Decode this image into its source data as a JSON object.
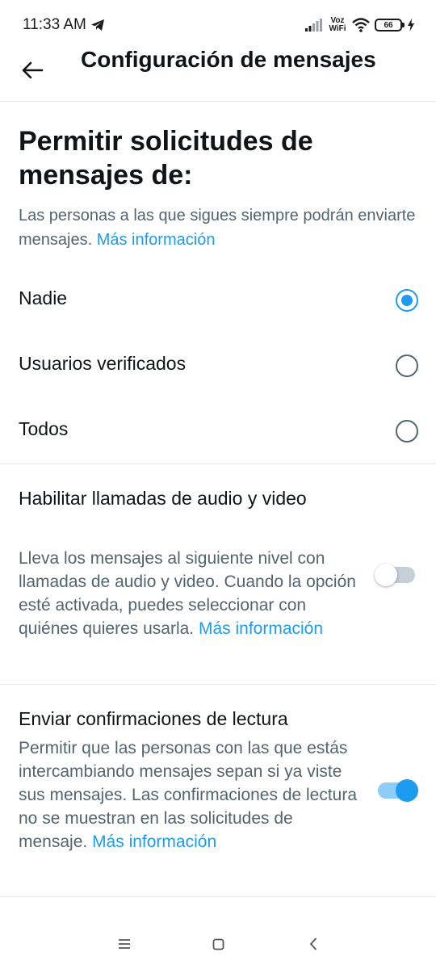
{
  "status_bar": {
    "time": "11:33 AM",
    "network_label": "Voz WiFi",
    "battery": "66",
    "icons": [
      "telegram-icon",
      "signal-icon",
      "wifi-icon",
      "battery-icon",
      "bolt-icon"
    ]
  },
  "header": {
    "back_icon": "arrow-left-icon",
    "title": "Configuración de mensajes"
  },
  "message_requests": {
    "heading": "Permitir solicitudes de mensajes de:",
    "description": "Las personas a las que sigues siempre podrán enviarte mensajes.",
    "link": "Más información",
    "options": [
      {
        "label": "Nadie",
        "selected": true
      },
      {
        "label": "Usuarios verificados",
        "selected": false
      },
      {
        "label": "Todos",
        "selected": false
      }
    ]
  },
  "calls": {
    "title": "Habilitar llamadas de audio y video",
    "description": "Lleva los mensajes al siguiente nivel con llamadas de audio y video. Cuando la opción esté activada, puedes seleccionar con quiénes quieres usarla.",
    "link": "Más información",
    "enabled": false
  },
  "read_receipts": {
    "title": "Enviar confirmaciones de lectura",
    "description": "Permitir que las personas con las que estás intercambiando mensajes sepan si ya viste sus mensajes. Las confirmaciones de lectura no se muestran en las solicitudes de mensaje.",
    "link": "Más información",
    "enabled": true
  },
  "colors": {
    "accent": "#1d9bf0",
    "text_primary": "#0f1419",
    "text_secondary": "#536471",
    "divider": "#e6e9eb"
  },
  "nav_bar": {
    "icons": [
      "menu-icon",
      "home-square-icon",
      "back-chevron-icon"
    ]
  }
}
